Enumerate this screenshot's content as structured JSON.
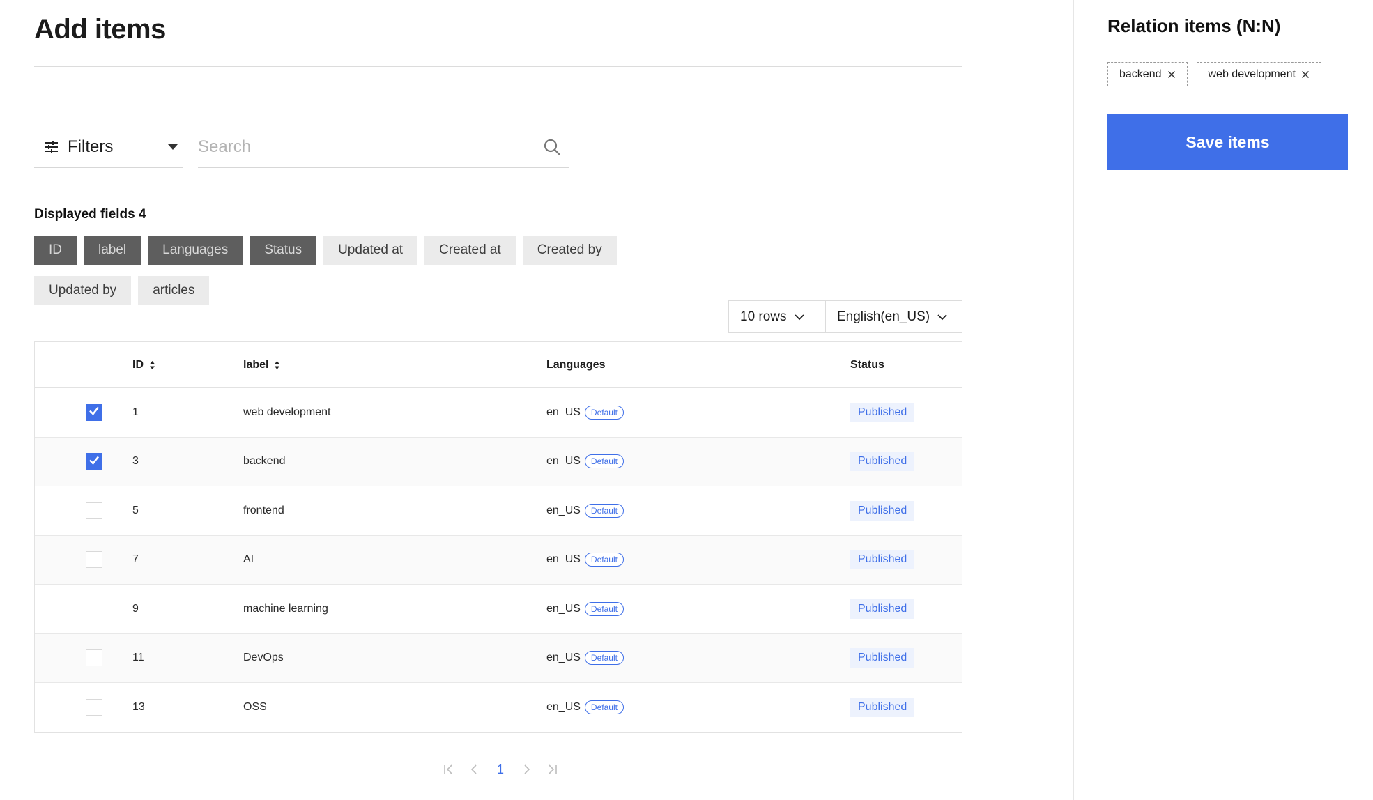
{
  "header": {
    "title": "Add items"
  },
  "filters": {
    "label": "Filters",
    "icon": "sliders-icon"
  },
  "search": {
    "placeholder": "Search",
    "value": "",
    "icon": "search-icon"
  },
  "fields": {
    "title": "Displayed fields",
    "count": "4",
    "items": [
      {
        "label": "ID",
        "on": true
      },
      {
        "label": "label",
        "on": true
      },
      {
        "label": "Languages",
        "on": true
      },
      {
        "label": "Status",
        "on": true
      },
      {
        "label": "Updated at",
        "on": false
      },
      {
        "label": "Created at",
        "on": false
      },
      {
        "label": "Created by",
        "on": false
      },
      {
        "label": "Updated by",
        "on": false
      },
      {
        "label": "articles",
        "on": false
      }
    ]
  },
  "controls": {
    "rows": "10 rows",
    "language": "English(en_US)"
  },
  "table": {
    "columns": [
      "ID",
      "label",
      "Languages",
      "Status"
    ],
    "default_tag": "Default",
    "rows": [
      {
        "id": "1",
        "label": "web development",
        "lang": "en_US",
        "status": "Published",
        "checked": true
      },
      {
        "id": "3",
        "label": "backend",
        "lang": "en_US",
        "status": "Published",
        "checked": true
      },
      {
        "id": "5",
        "label": "frontend",
        "lang": "en_US",
        "status": "Published",
        "checked": false
      },
      {
        "id": "7",
        "label": "AI",
        "lang": "en_US",
        "status": "Published",
        "checked": false
      },
      {
        "id": "9",
        "label": "machine learning",
        "lang": "en_US",
        "status": "Published",
        "checked": false
      },
      {
        "id": "11",
        "label": "DevOps",
        "lang": "en_US",
        "status": "Published",
        "checked": false
      },
      {
        "id": "13",
        "label": "OSS",
        "lang": "en_US",
        "status": "Published",
        "checked": false
      }
    ]
  },
  "pagination": {
    "current": "1"
  },
  "side": {
    "title": "Relation items (N:N)",
    "tags": [
      "backend",
      "web development"
    ],
    "save_label": "Save items"
  },
  "colors": {
    "accent": "#3f6fe8",
    "chip_on": "#5e5e5e",
    "chip_off": "#ebebeb"
  }
}
